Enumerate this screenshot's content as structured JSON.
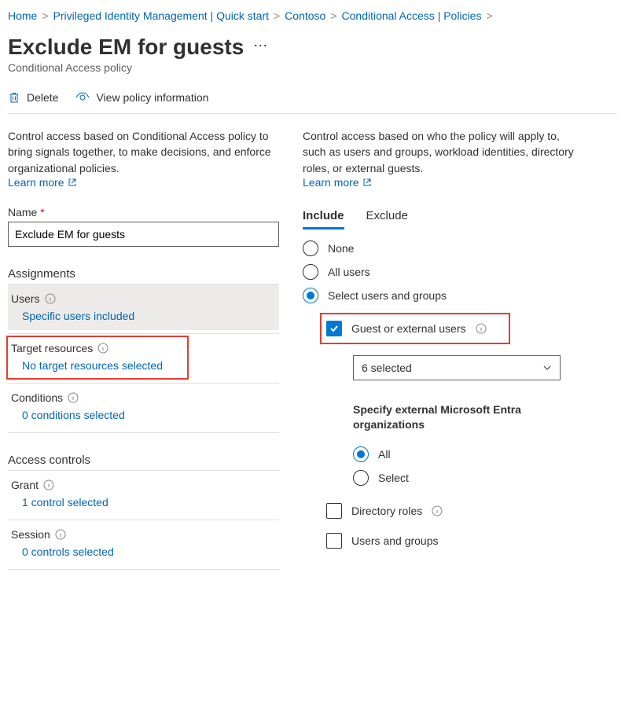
{
  "breadcrumb": {
    "home": "Home",
    "pim": "Privileged Identity Management | Quick start",
    "contoso": "Contoso",
    "ca": "Conditional Access | Policies"
  },
  "header": {
    "title": "Exclude EM for guests",
    "subtitle": "Conditional Access policy"
  },
  "toolbar": {
    "delete": "Delete",
    "view_info": "View policy information"
  },
  "left": {
    "desc": "Control access based on Conditional Access policy to bring signals together, to make decisions, and enforce organizational policies.",
    "learn_more": "Learn more",
    "name_label": "Name",
    "name_value": "Exclude EM for guests",
    "assignments_head": "Assignments",
    "users_label": "Users",
    "users_link": "Specific users included",
    "target_label": "Target resources",
    "target_link": "No target resources selected",
    "conditions_label": "Conditions",
    "conditions_link": "0 conditions selected",
    "access_head": "Access controls",
    "grant_label": "Grant",
    "grant_link": "1 control selected",
    "session_label": "Session",
    "session_link": "0 controls selected"
  },
  "right": {
    "desc": "Control access based on who the policy will apply to, such as users and groups, workload identities, directory roles, or external guests.",
    "learn_more": "Learn more",
    "tab_include": "Include",
    "tab_exclude": "Exclude",
    "opt_none": "None",
    "opt_all": "All users",
    "opt_select": "Select users and groups",
    "guest_label": "Guest or external users",
    "dropdown_value": "6 selected",
    "specify_head": "Specify external Microsoft Entra organizations",
    "opt_orgs_all": "All",
    "opt_orgs_select": "Select",
    "dir_roles": "Directory roles",
    "users_groups": "Users and groups"
  }
}
